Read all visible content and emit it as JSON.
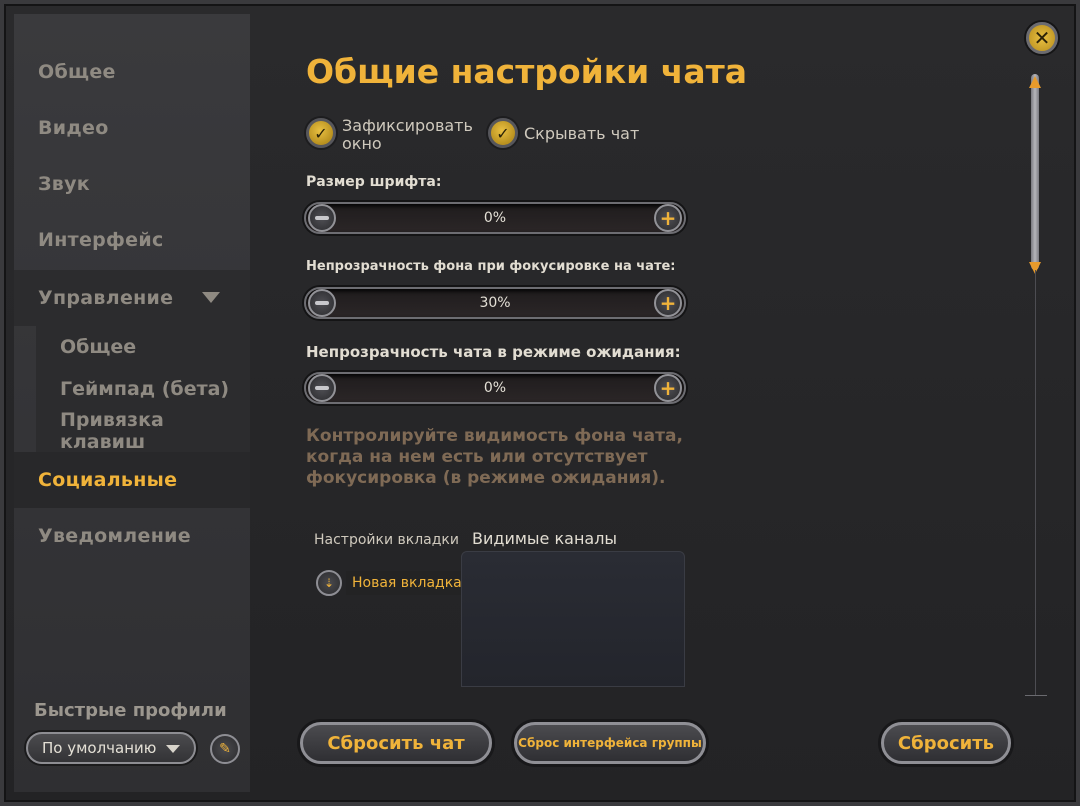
{
  "colors": {
    "accent": "#f0b33a",
    "muted_text": "#8f8a82",
    "help_text": "#7f6a55"
  },
  "sidebar": {
    "items": [
      {
        "label": "Общее"
      },
      {
        "label": "Видео"
      },
      {
        "label": "Звук"
      },
      {
        "label": "Интерфейс"
      },
      {
        "label": "Управление"
      },
      {
        "label": "Социальные"
      },
      {
        "label": "Уведомление"
      }
    ],
    "subitems": [
      {
        "label": "Общее"
      },
      {
        "label": "Геймпад (бета)"
      },
      {
        "label": "Привязка клавиш"
      }
    ],
    "active": "Социальные",
    "quick_profiles_label": "Быстрые профили",
    "profile_selected": "По умолчанию",
    "edit_icon": "pencil-icon"
  },
  "main": {
    "title": "Общие настройки чата",
    "checkboxes": [
      {
        "label": "Зафиксировать окно",
        "checked": true
      },
      {
        "label": "Скрывать чат",
        "checked": true
      }
    ],
    "sliders": [
      {
        "label": "Размер шрифта:",
        "value": "0%"
      },
      {
        "label": "Непрозрачность фона при фокусировке на чате:",
        "value": "30%"
      },
      {
        "label": "Непрозрачность чата в режиме ожидания:",
        "value": "0%"
      }
    ],
    "help_text": "Контролируйте видимость фона чата, когда на нем есть или отсутствует фокусировка (в режиме ожидания).",
    "tab_settings_label": "Настройки вкладки",
    "new_tab_label": "Новая вкладка",
    "visible_channels_label": "Видимые каналы"
  },
  "footer": {
    "reset_chat": "Сбросить чат",
    "reset_group_ui": "Сброс интерфейса группы",
    "reset": "Сбросить"
  }
}
